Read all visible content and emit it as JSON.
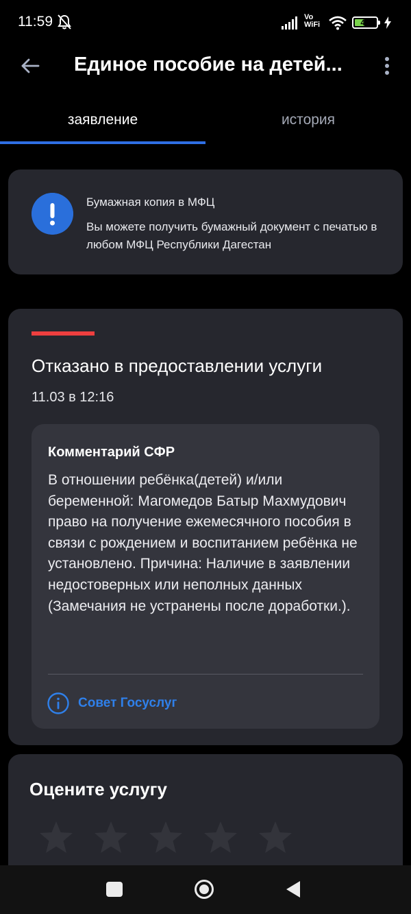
{
  "status_bar": {
    "time": "11:59",
    "vowifi_top": "Vo",
    "vowifi_bottom": "WiFi",
    "battery": "42"
  },
  "app_bar": {
    "title": "Единое пособие на детей..."
  },
  "tabs": [
    {
      "label": "заявление",
      "active": true
    },
    {
      "label": "история",
      "active": false
    }
  ],
  "info_card": {
    "title": "Бумажная копия в МФЦ",
    "text": "Вы можете получить бумажный документ с печатью в любом МФЦ Республики Дагестан"
  },
  "status_card": {
    "title": "Отказано в предоставлении услуги",
    "date": "11.03 в 12:16",
    "comment_title": "Комментарий СФР",
    "comment_text": "В отношении ребёнка(детей) и/или беременной: Магомедов Батыр Махмудович право на получение ежемесячного пособия в связи с рождением и воспитанием ребёнка не установлено. Причина: Наличие в заявлении недостоверных или неполных данных (Замечания не устранены после доработки.).",
    "advice_label": "Совет Госуслуг"
  },
  "rating_card": {
    "title": "Оцените услугу",
    "stars": 5
  },
  "colors": {
    "accent": "#2f6fe4",
    "link": "#2f80ea",
    "error": "#ee3f3f",
    "card": "#26272e"
  }
}
